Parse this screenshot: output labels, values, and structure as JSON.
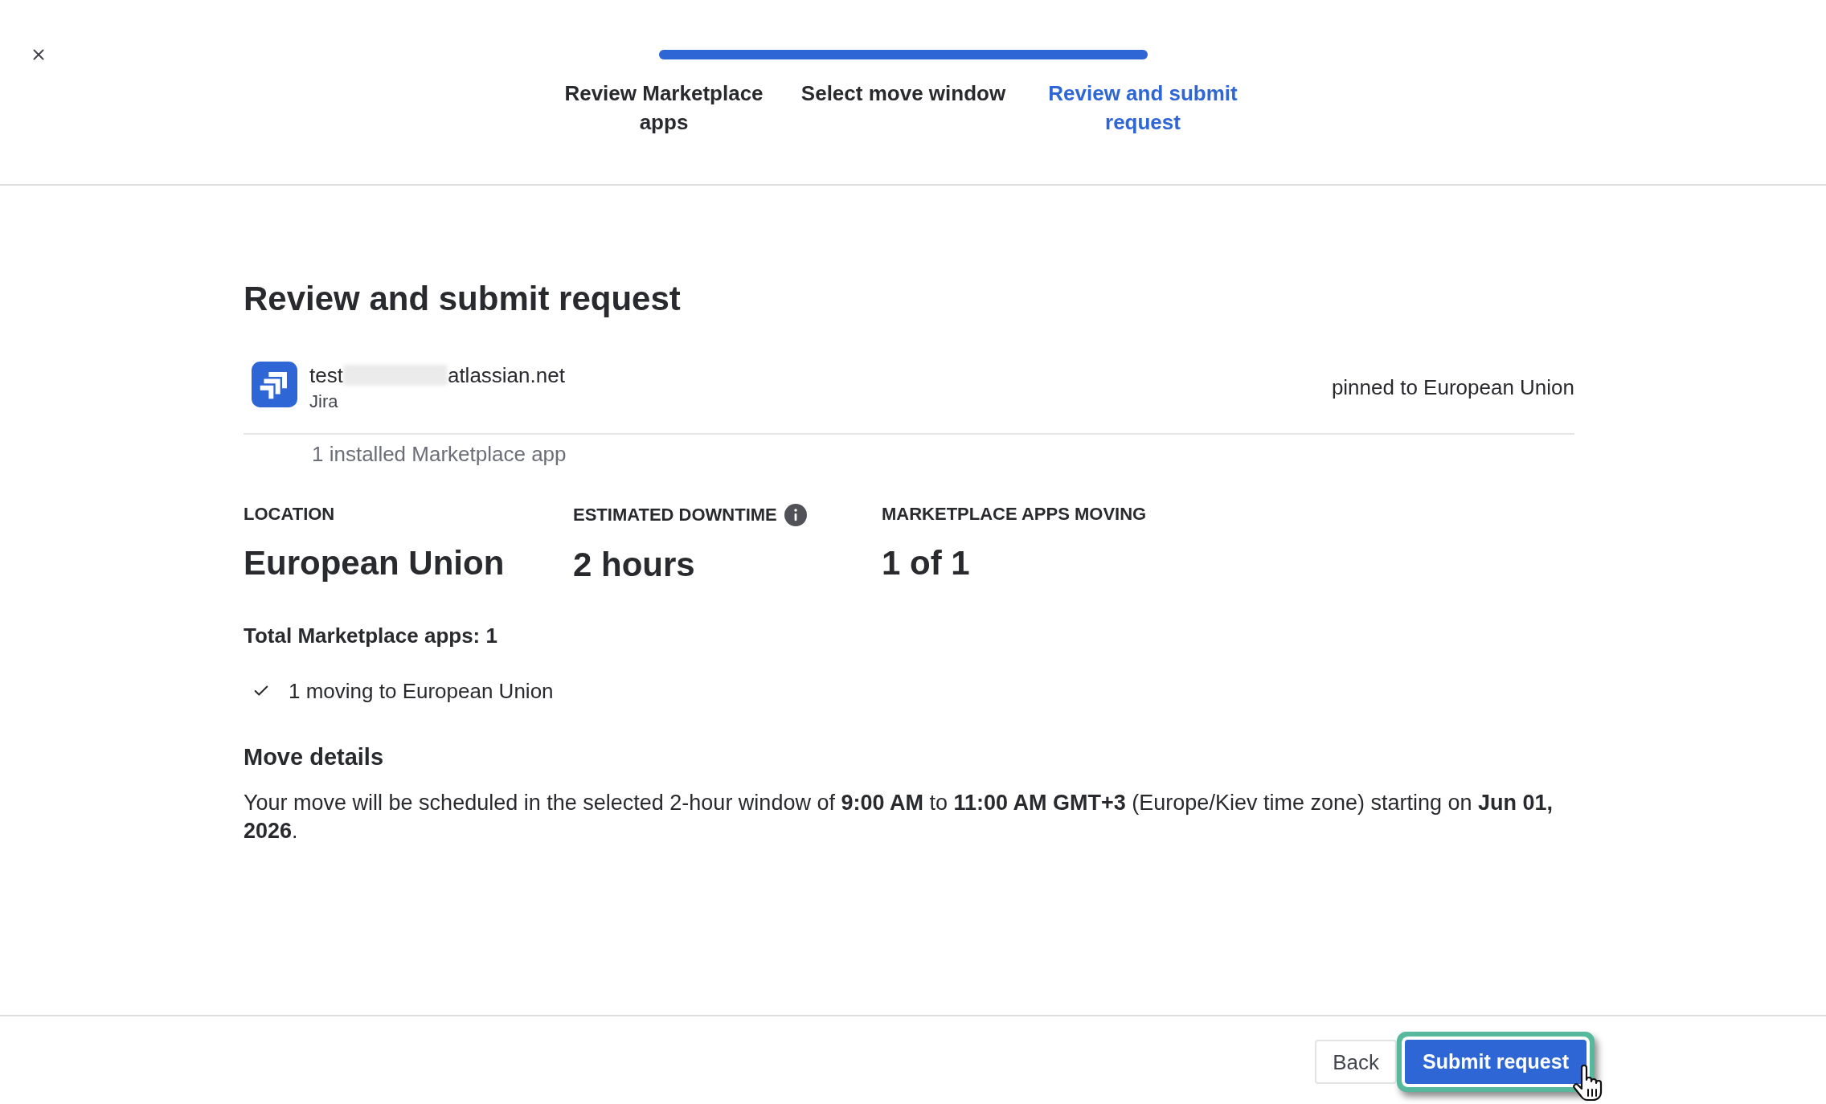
{
  "stepper": {
    "progress": {
      "level": 1
    },
    "steps": [
      {
        "label": "Review Marketplace apps",
        "selected": false
      },
      {
        "label": "Select move window",
        "selected": false
      },
      {
        "label": "Review and submit request",
        "selected": true
      }
    ]
  },
  "page": {
    "title": "Review and submit request"
  },
  "site": {
    "name_start": "test",
    "name_end": "atlassian.net",
    "product": "Jira",
    "pinned": "pinned to European Union",
    "apps_installed": "1 installed Marketplace app"
  },
  "stats": [
    {
      "label": "LOCATION",
      "value": "European Union",
      "info": false
    },
    {
      "label": "ESTIMATED DOWNTIME",
      "value": "2 hours",
      "info": true
    },
    {
      "label": "MARKETPLACE APPS MOVING",
      "value": "1 of 1",
      "info": false
    }
  ],
  "summary": {
    "title": "Total Marketplace apps: 1",
    "items": [
      "1 moving to European Union"
    ]
  },
  "move_details": {
    "title": "Move details",
    "text": "Your move will be scheduled in the selected 2-hour window of **9:00 AM** to **11:00 AM GMT+3** (Europe/Kiev time zone) starting on **Jun 01, 2026**."
  },
  "footer": {
    "buttons": [
      {
        "label": "Back",
        "kind": "secondary",
        "highlighted": false
      },
      {
        "label": "Submit request",
        "kind": "primary",
        "highlighted": true
      }
    ]
  }
}
